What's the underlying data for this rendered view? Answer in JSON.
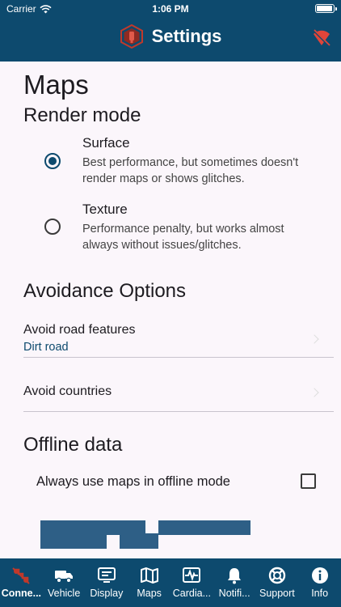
{
  "status_bar": {
    "carrier": "Carrier",
    "time": "1:06 PM"
  },
  "header": {
    "title": "Settings",
    "logo": "hexagon-logo-icon",
    "action_icon": "wifi-off-icon"
  },
  "page": {
    "title": "Maps"
  },
  "render_mode": {
    "title": "Render mode",
    "options": [
      {
        "label": "Surface",
        "description": "Best performance, but sometimes doesn't render maps or shows glitches.",
        "selected": true
      },
      {
        "label": "Texture",
        "description": "Performance penalty, but works almost always without issues/glitches.",
        "selected": false
      }
    ]
  },
  "avoidance": {
    "title": "Avoidance Options",
    "road_features": {
      "label": "Avoid road features",
      "value": "Dirt road"
    },
    "countries": {
      "label": "Avoid countries"
    }
  },
  "offline": {
    "title": "Offline data",
    "always_offline": {
      "label": "Always use maps in offline mode",
      "checked": false
    }
  },
  "colors": {
    "primary": "#0d4a6e",
    "background": "#fbf6fb",
    "accent_red": "#c0392b"
  },
  "bottom_nav": [
    {
      "label": "Conne...",
      "icon": "connection-off-icon",
      "active": true
    },
    {
      "label": "Vehicle",
      "icon": "truck-icon"
    },
    {
      "label": "Display",
      "icon": "display-icon"
    },
    {
      "label": "Maps",
      "icon": "map-icon"
    },
    {
      "label": "Cardia...",
      "icon": "heart-rate-icon"
    },
    {
      "label": "Notifi...",
      "icon": "bell-icon"
    },
    {
      "label": "Support",
      "icon": "lifebuoy-icon"
    },
    {
      "label": "Info",
      "icon": "info-icon"
    }
  ]
}
